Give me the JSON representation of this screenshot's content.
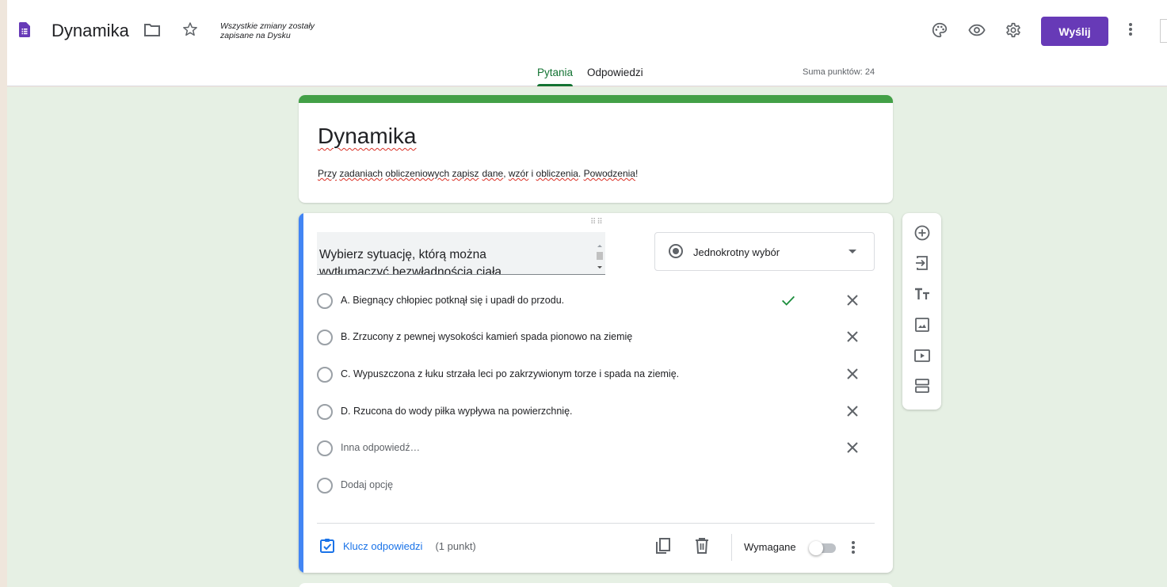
{
  "colors": {
    "brand_purple": "#673ab7",
    "accent_green": "#43a047",
    "tab_active": "#137333",
    "link_blue": "#1a73e8",
    "question_accent": "#4285f4",
    "page_bg": "#e6f0e4"
  },
  "header": {
    "app_icon": "google-forms-icon",
    "doc_title": "Dynamika",
    "save_status_line1": "Wszystkie zmiany zostały",
    "save_status_line2": "zapisane na Dysku",
    "send_label": "Wyślij",
    "icons": [
      "folder-icon",
      "star-icon",
      "palette-icon",
      "eye-preview-icon",
      "gear-icon",
      "more-vert-icon"
    ]
  },
  "tabs": [
    {
      "label": "Pytania",
      "active": true
    },
    {
      "label": "Odpowiedzi",
      "active": false
    }
  ],
  "total_points": "Suma punktów: 24",
  "form": {
    "title": "Dynamika",
    "description_parts": [
      "Przy",
      "zadaniach",
      "obliczeniowych",
      "zapisz",
      "dane",
      ", ",
      "wzór",
      " i ",
      "obliczenia",
      ". ",
      "Powodzenia",
      "!"
    ]
  },
  "question": {
    "text_line1": "Wybierz sytuację, którą można",
    "text_line2": "wytłumaczyć bezwładnością ciała",
    "type": "Jednokrotny wybór",
    "options": [
      {
        "label": "A. Biegnący chłopiec potknął się i upadł do przodu.",
        "correct": true
      },
      {
        "label": "B. Zrzucony z pewnej wysokości kamień spada pionowo na ziemię",
        "correct": false
      },
      {
        "label": "C. Wypuszczona z łuku strzała leci po zakrzywionym torze i spada na ziemię.",
        "correct": false
      },
      {
        "label": "D. Rzucona do wody piłka wypływa na powierzchnię.",
        "correct": false
      }
    ],
    "other_label": "Inna odpowiedź…",
    "add_option_label": "Dodaj opcję",
    "answer_key_label": "Klucz odpowiedzi",
    "points_label": "(1 punkt)",
    "required_label": "Wymagane",
    "required_on": false
  },
  "side_toolbar": [
    "add-question-icon",
    "import-questions-icon",
    "add-title-icon",
    "add-image-icon",
    "add-video-icon",
    "add-section-icon"
  ]
}
